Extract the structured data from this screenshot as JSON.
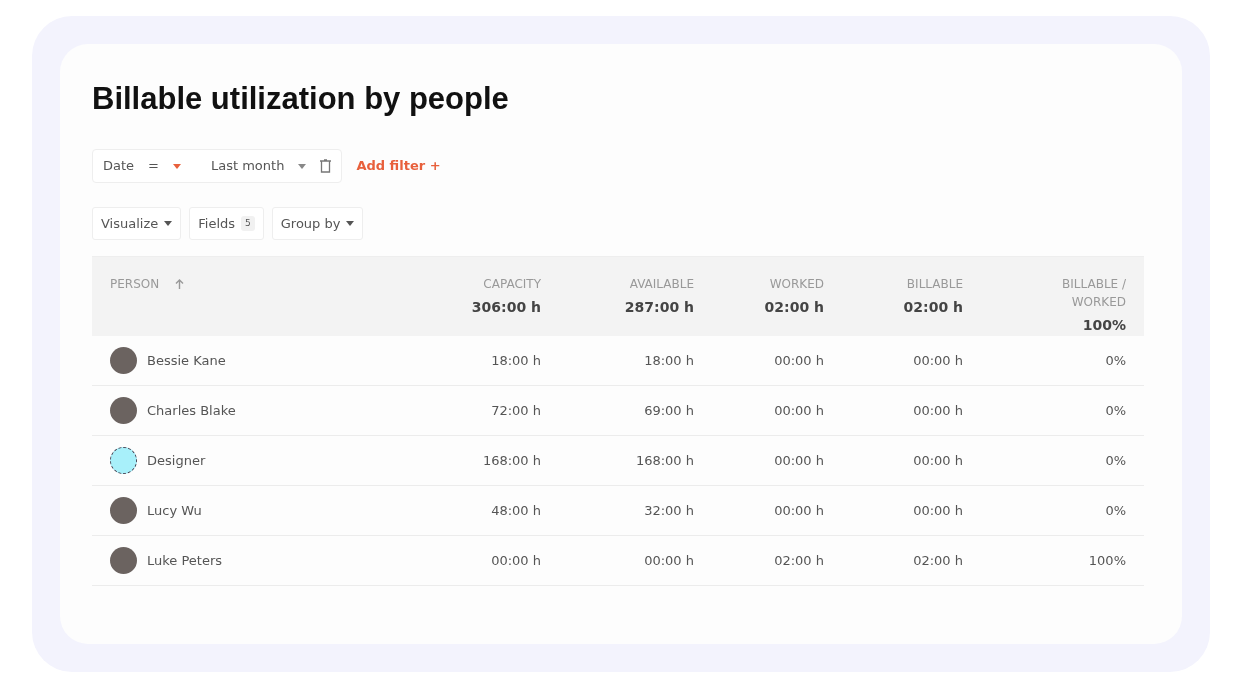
{
  "title": "Billable utilization by people",
  "filter": {
    "field": "Date",
    "operator": "=",
    "value": "Last month"
  },
  "add_filter": "Add filter +",
  "toolbar": [
    {
      "label": "Visualize",
      "kind": "dropdown"
    },
    {
      "label": "Fields",
      "kind": "count",
      "count": "5"
    },
    {
      "label": "Group by",
      "kind": "dropdown"
    }
  ],
  "table": {
    "columns": [
      {
        "label": "PERSON",
        "sorted": true
      },
      {
        "label": "CAPACITY",
        "total": "306:00 h",
        "sorted": false
      },
      {
        "label": "AVAILABLE",
        "total": "287:00 h",
        "sorted": false
      },
      {
        "label": "WORKED",
        "total": "02:00 h",
        "sorted": false
      },
      {
        "label": "BILLABLE",
        "total": "02:00 h",
        "sorted": false
      },
      {
        "label": "BILLABLE / WORKED",
        "total": "100%",
        "sorted": false
      }
    ],
    "rows": [
      {
        "kind": "person",
        "cells": [
          "Bessie Kane",
          "18:00 h",
          "18:00 h",
          "00:00 h",
          "00:00 h",
          "0%"
        ]
      },
      {
        "kind": "person",
        "cells": [
          "Charles Blake",
          "72:00 h",
          "69:00 h",
          "00:00 h",
          "00:00 h",
          "0%"
        ]
      },
      {
        "kind": "role",
        "cells": [
          "Designer",
          "168:00 h",
          "168:00 h",
          "00:00 h",
          "00:00 h",
          "0%"
        ]
      },
      {
        "kind": "person",
        "cells": [
          "Lucy Wu",
          "48:00 h",
          "32:00 h",
          "00:00 h",
          "00:00 h",
          "0%"
        ]
      },
      {
        "kind": "person",
        "cells": [
          "Luke Peters",
          "00:00 h",
          "00:00 h",
          "02:00 h",
          "02:00 h",
          "100%"
        ]
      }
    ]
  }
}
